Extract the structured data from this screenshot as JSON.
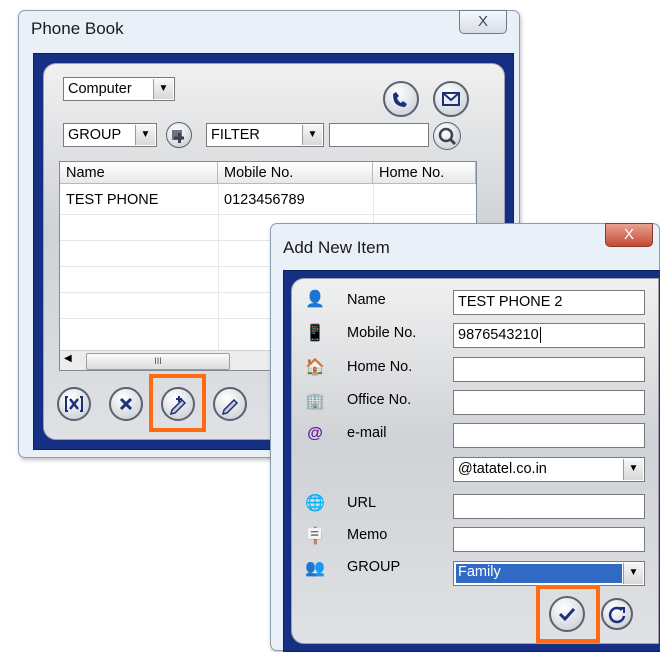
{
  "phonebook": {
    "title": "Phone Book",
    "close_label": "X",
    "source_select": "Computer",
    "group_select": "GROUP",
    "filter_select": "FILTER",
    "search_value": "",
    "columns": [
      "Name",
      "Mobile No.",
      "Home No."
    ],
    "rows": [
      {
        "name": "TEST PHONE",
        "mobile": "0123456789",
        "home": ""
      }
    ],
    "scroll_grip": "III",
    "buttons": {
      "call_icon": "phone",
      "sms_icon": "envelope",
      "search_icon": "magnifier",
      "add_group_icon": "plus",
      "delete_all_icon": "delete-all",
      "delete_icon": "x",
      "add_new_icon": "add-pencil",
      "edit_icon": "pencil"
    }
  },
  "add_item": {
    "title": "Add New Item",
    "close_label": "X",
    "fields": {
      "name": {
        "label": "Name",
        "value": "TEST PHONE 2"
      },
      "mobile": {
        "label": "Mobile No.",
        "value": "9876543210"
      },
      "home": {
        "label": "Home No.",
        "value": ""
      },
      "office": {
        "label": "Office No.",
        "value": ""
      },
      "email": {
        "label": "e-mail",
        "value": ""
      },
      "email_domain": {
        "value": "@tatatel.co.in"
      },
      "url": {
        "label": "URL",
        "value": ""
      },
      "memo": {
        "label": "Memo",
        "value": ""
      },
      "group": {
        "label": "GROUP",
        "value": "Family"
      }
    },
    "buttons": {
      "ok_icon": "check",
      "reset_icon": "refresh"
    }
  },
  "colors": {
    "highlight": "#ff6a13",
    "frame_blue": "#142f84",
    "selection_blue": "#316ac5"
  }
}
